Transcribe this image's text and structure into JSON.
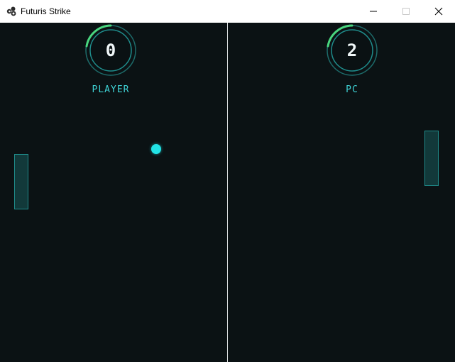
{
  "window": {
    "title": "Futuris Strike",
    "controls": {
      "minimize": "minimize-icon",
      "maximize": "maximize-icon",
      "close": "close-icon"
    }
  },
  "game": {
    "player": {
      "name": "PLAYER",
      "score": "0"
    },
    "pc": {
      "name": "PC",
      "score": "2"
    }
  },
  "colors": {
    "background": "#0b1214",
    "accent": "#3fd3d6",
    "ball": "#22e3e6",
    "ring_progress": "#49d67f",
    "paddle_fill": "#12393a",
    "paddle_border": "#1f8d8c",
    "divider": "#d8dcdd"
  }
}
